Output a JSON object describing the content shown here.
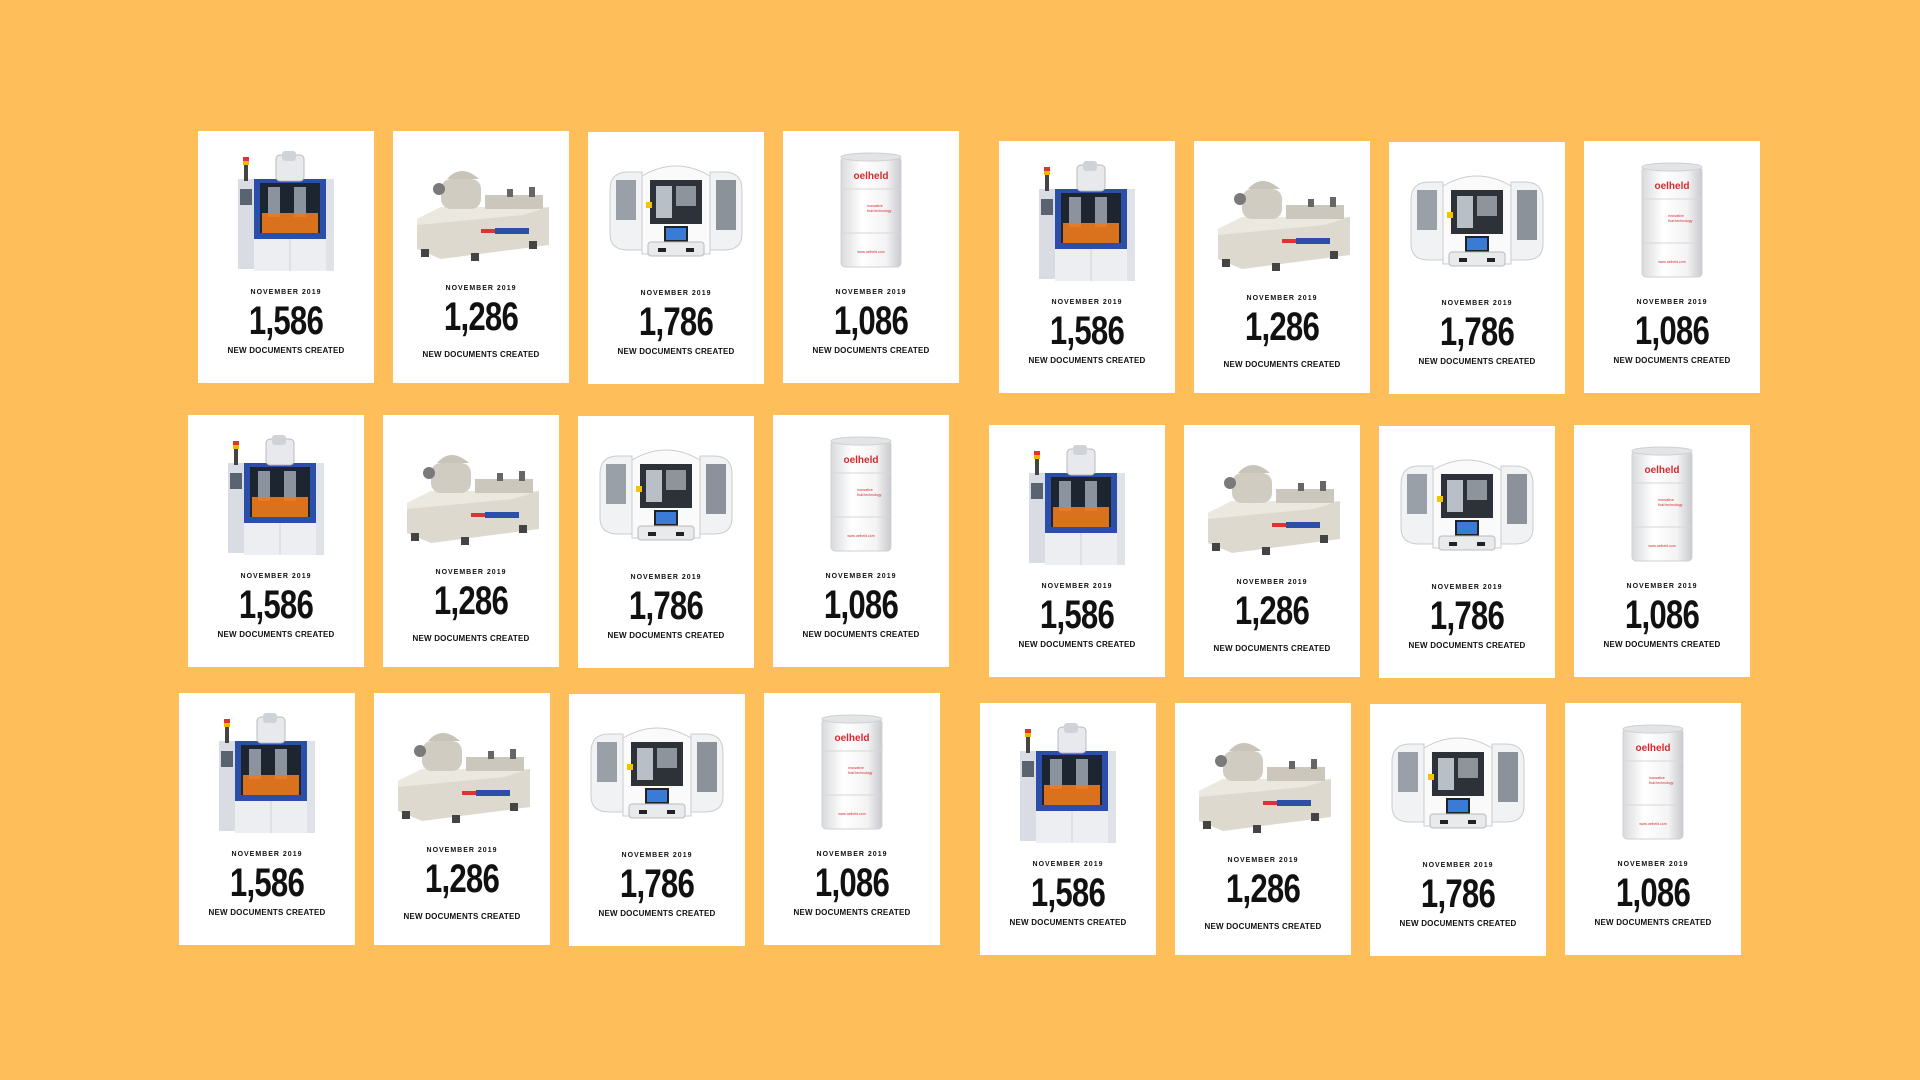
{
  "background_color": "#FEBE5A",
  "colors": {
    "card": "#FFFFFF",
    "text": "#111111",
    "machine_blue": "#2B4FA8",
    "machine_orange": "#F07A1C",
    "brand_red": "#D42A2A"
  },
  "groups": [
    {
      "cards": [
        {
          "image": "blue-machine-icon",
          "month": "NOVEMBER 2019",
          "count": "1,586",
          "caption": "NEW DOCUMENTS CREATED"
        },
        {
          "image": "grinding-machine-icon",
          "month": "NOVEMBER 2019",
          "count": "1,286",
          "caption": "NEW DOCUMENTS CREATED"
        },
        {
          "image": "robot-cell-icon",
          "month": "NOVEMBER 2019",
          "count": "1,786",
          "caption": "NEW DOCUMENTS CREATED"
        },
        {
          "image": "oelheld-drum-icon",
          "month": "NOVEMBER 2019",
          "count": "1,086",
          "caption": "NEW DOCUMENTS CREATED",
          "brand": "oelheld",
          "drum_text_1": "innovative",
          "drum_text_2": "fluid technology",
          "drum_url": "www.oelheld.com"
        }
      ]
    },
    {
      "cards": [
        {
          "image": "blue-machine-icon",
          "month": "NOVEMBER 2019",
          "count": "1,586",
          "caption": "NEW DOCUMENTS CREATED"
        },
        {
          "image": "grinding-machine-icon",
          "month": "NOVEMBER 2019",
          "count": "1,286",
          "caption": "NEW DOCUMENTS CREATED"
        },
        {
          "image": "robot-cell-icon",
          "month": "NOVEMBER 2019",
          "count": "1,786",
          "caption": "NEW DOCUMENTS CREATED"
        },
        {
          "image": "oelheld-drum-icon",
          "month": "NOVEMBER 2019",
          "count": "1,086",
          "caption": "NEW DOCUMENTS CREATED",
          "brand": "oelheld",
          "drum_text_1": "innovative",
          "drum_text_2": "fluid technology",
          "drum_url": "www.oelheld.com"
        }
      ]
    },
    {
      "cards": [
        {
          "image": "blue-machine-icon",
          "month": "NOVEMBER 2019",
          "count": "1,586",
          "caption": "NEW DOCUMENTS CREATED"
        },
        {
          "image": "grinding-machine-icon",
          "month": "NOVEMBER 2019",
          "count": "1,286",
          "caption": "NEW DOCUMENTS CREATED"
        },
        {
          "image": "robot-cell-icon",
          "month": "NOVEMBER 2019",
          "count": "1,786",
          "caption": "NEW DOCUMENTS CREATED"
        },
        {
          "image": "oelheld-drum-icon",
          "month": "NOVEMBER 2019",
          "count": "1,086",
          "caption": "NEW DOCUMENTS CREATED",
          "brand": "oelheld",
          "drum_text_1": "innovative",
          "drum_text_2": "fluid technology",
          "drum_url": "www.oelheld.com"
        }
      ]
    },
    {
      "cards": [
        {
          "image": "blue-machine-icon",
          "month": "NOVEMBER 2019",
          "count": "1,586",
          "caption": "NEW DOCUMENTS CREATED"
        },
        {
          "image": "grinding-machine-icon",
          "month": "NOVEMBER 2019",
          "count": "1,286",
          "caption": "NEW DOCUMENTS CREATED"
        },
        {
          "image": "robot-cell-icon",
          "month": "NOVEMBER 2019",
          "count": "1,786",
          "caption": "NEW DOCUMENTS CREATED"
        },
        {
          "image": "oelheld-drum-icon",
          "month": "NOVEMBER 2019",
          "count": "1,086",
          "caption": "NEW DOCUMENTS CREATED",
          "brand": "oelheld",
          "drum_text_1": "innovative",
          "drum_text_2": "fluid technology",
          "drum_url": "www.oelheld.com"
        }
      ]
    },
    {
      "cards": [
        {
          "image": "blue-machine-icon",
          "month": "NOVEMBER 2019",
          "count": "1,586",
          "caption": "NEW DOCUMENTS CREATED"
        },
        {
          "image": "grinding-machine-icon",
          "month": "NOVEMBER 2019",
          "count": "1,286",
          "caption": "NEW DOCUMENTS CREATED"
        },
        {
          "image": "robot-cell-icon",
          "month": "NOVEMBER 2019",
          "count": "1,786",
          "caption": "NEW DOCUMENTS CREATED"
        },
        {
          "image": "oelheld-drum-icon",
          "month": "NOVEMBER 2019",
          "count": "1,086",
          "caption": "NEW DOCUMENTS CREATED",
          "brand": "oelheld",
          "drum_text_1": "innovative",
          "drum_text_2": "fluid technology",
          "drum_url": "www.oelheld.com"
        }
      ]
    },
    {
      "cards": [
        {
          "image": "blue-machine-icon",
          "month": "NOVEMBER 2019",
          "count": "1,586",
          "caption": "NEW DOCUMENTS CREATED"
        },
        {
          "image": "grinding-machine-icon",
          "month": "NOVEMBER 2019",
          "count": "1,286",
          "caption": "NEW DOCUMENTS CREATED"
        },
        {
          "image": "robot-cell-icon",
          "month": "NOVEMBER 2019",
          "count": "1,786",
          "caption": "NEW DOCUMENTS CREATED"
        },
        {
          "image": "oelheld-drum-icon",
          "month": "NOVEMBER 2019",
          "count": "1,086",
          "caption": "NEW DOCUMENTS CREATED",
          "brand": "oelheld",
          "drum_text_1": "innovative",
          "drum_text_2": "fluid technology",
          "drum_url": "www.oelheld.com"
        }
      ]
    }
  ]
}
